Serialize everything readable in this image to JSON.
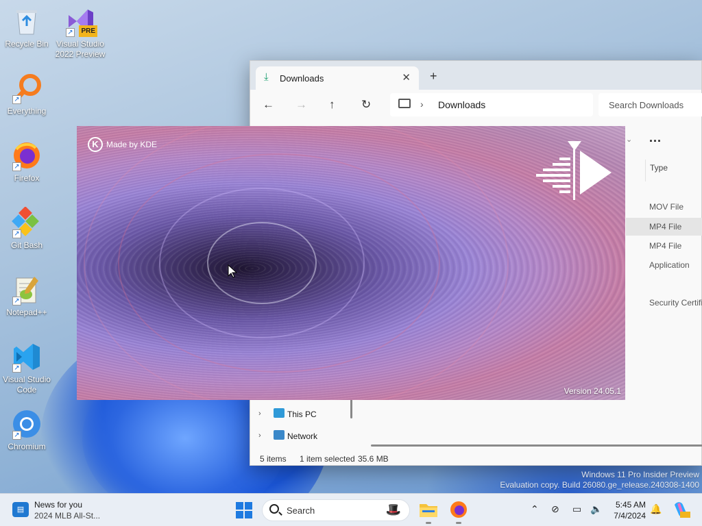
{
  "desktop": {
    "icons": [
      {
        "label": "Recycle Bin"
      },
      {
        "label": "Visual Studio 2022 Preview",
        "badge": "PRE"
      },
      {
        "label": "Everything"
      },
      {
        "label": "Firefox"
      },
      {
        "label": "Git Bash"
      },
      {
        "label": "Notepad++"
      },
      {
        "label": "Visual Studio Code"
      },
      {
        "label": "Chromium"
      }
    ]
  },
  "explorer": {
    "tab_label": "Downloads",
    "address": "Downloads",
    "search_placeholder": "Search Downloads",
    "more_label": "...",
    "type_header": "Type",
    "types": [
      "MOV File",
      "MP4 File",
      "MP4 File",
      "Application",
      "Security Certifi"
    ],
    "nav_items": [
      {
        "label": "This PC"
      },
      {
        "label": "Network"
      }
    ],
    "status": {
      "items": "5 items",
      "selected": "1 item selected",
      "size": "35.6 MB"
    }
  },
  "splash": {
    "badge": "Made by KDE",
    "version": "Version 24.05.1"
  },
  "watermark": {
    "line1": "Windows 11 Pro Insider Preview",
    "line2": "Evaluation copy. Build 26080.ge_release.240308-1400"
  },
  "taskbar": {
    "news_title": "News for you",
    "news_subtitle": "2024 MLB All-St...",
    "search_placeholder": "Search",
    "time": "5:45 AM",
    "date": "7/4/2024"
  }
}
